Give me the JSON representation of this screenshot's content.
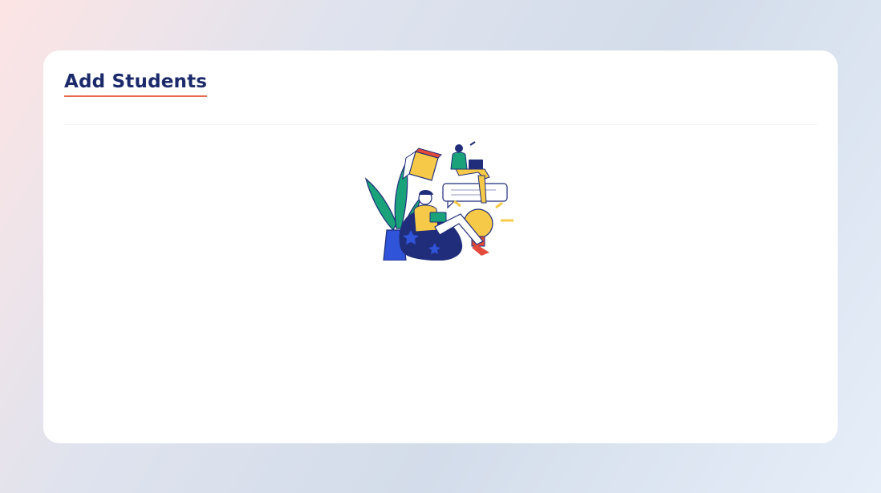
{
  "page": {
    "title": "Add Students"
  },
  "illustration": {
    "name": "students-studying-illustration",
    "colors": {
      "navy": "#1f2d7a",
      "blue": "#2f53d9",
      "green": "#1aa37a",
      "yellow": "#f7c948",
      "red": "#e24b3b",
      "white": "#ffffff"
    }
  }
}
